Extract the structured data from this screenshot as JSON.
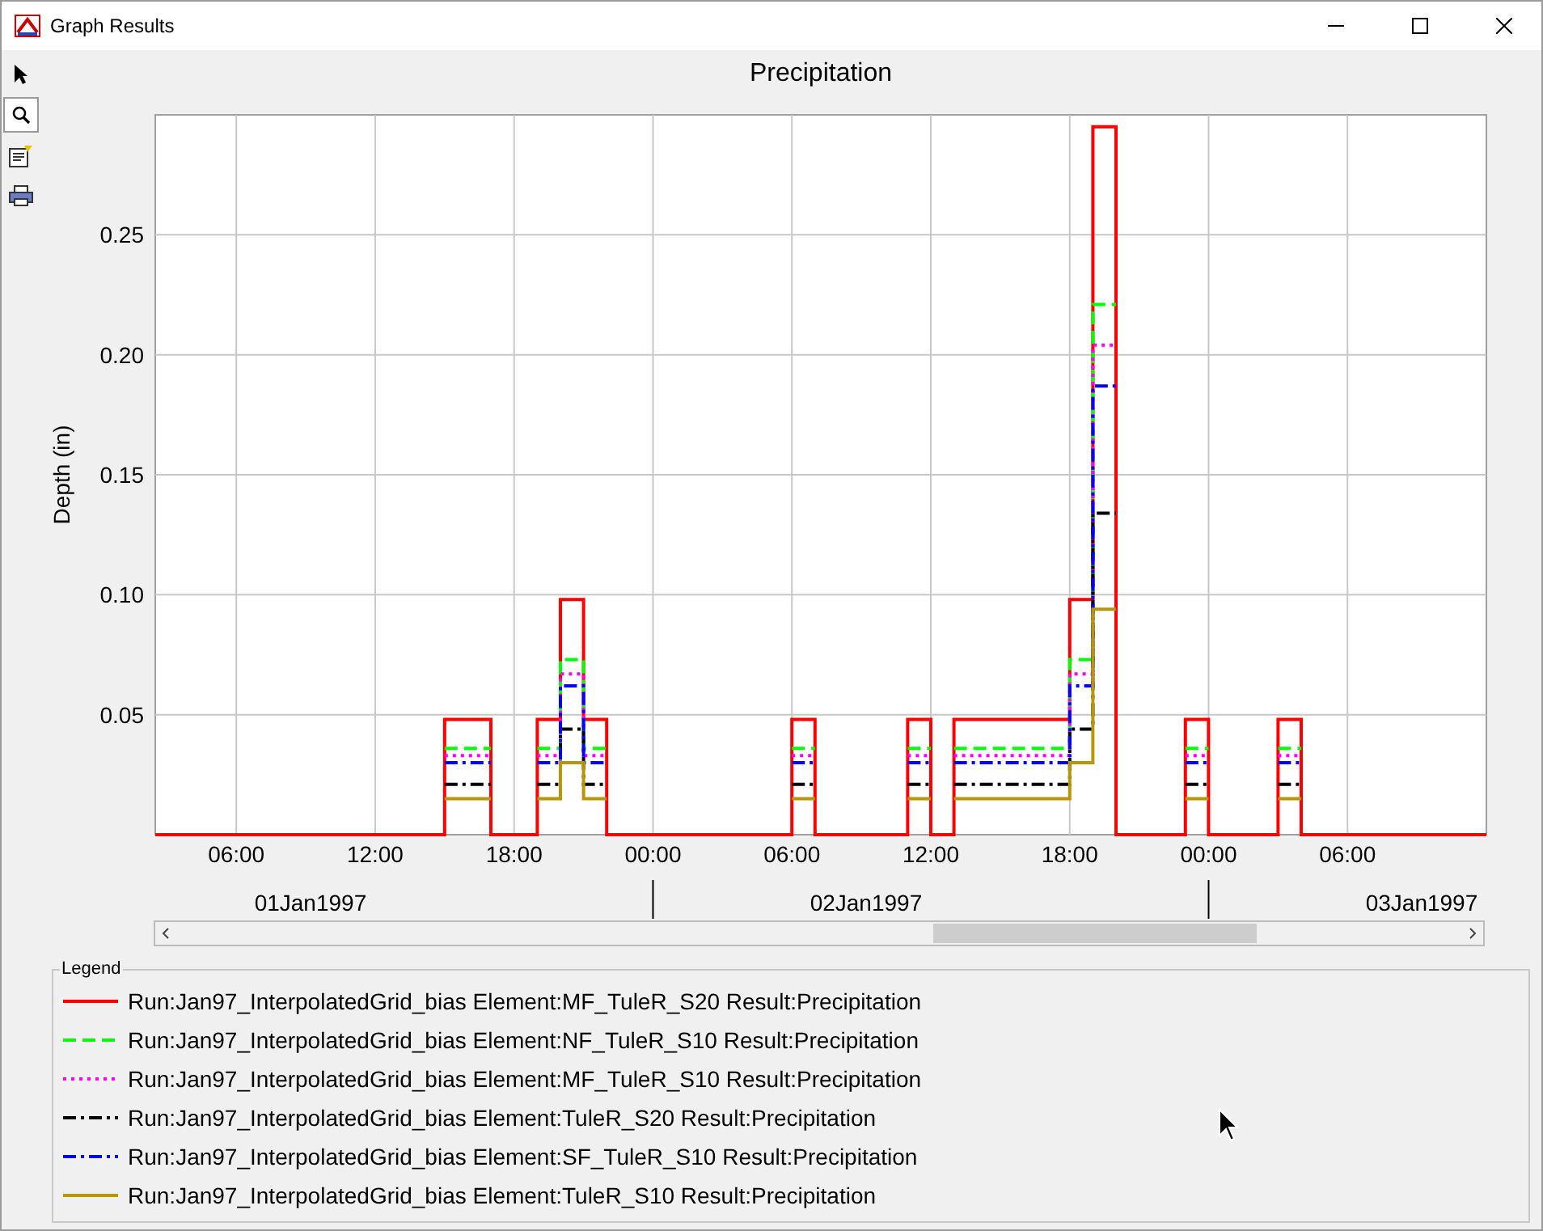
{
  "window": {
    "title": "Graph Results"
  },
  "tools": [
    {
      "kind": "pointer",
      "selected": false
    },
    {
      "kind": "zoom",
      "selected": true
    },
    {
      "kind": "properties",
      "selected": false
    },
    {
      "kind": "print",
      "selected": false
    }
  ],
  "chart": {
    "chart_data": {
      "type": "line",
      "title": "Precipitation",
      "ylabel": "Depth (in)",
      "grid": true,
      "xlim": [
        "1997-01-01T02:30",
        "1997-01-03T12:00"
      ],
      "ylim": [
        0,
        0.3
      ],
      "xticks": [
        {
          "value": "1997-01-01T06:00",
          "label": "06:00"
        },
        {
          "value": "1997-01-01T12:00",
          "label": "12:00"
        },
        {
          "value": "1997-01-01T18:00",
          "label": "18:00"
        },
        {
          "value": "1997-01-02T00:00",
          "label": "00:00"
        },
        {
          "value": "1997-01-02T06:00",
          "label": "06:00"
        },
        {
          "value": "1997-01-02T12:00",
          "label": "12:00"
        },
        {
          "value": "1997-01-02T18:00",
          "label": "18:00"
        },
        {
          "value": "1997-01-03T00:00",
          "label": "00:00"
        },
        {
          "value": "1997-01-03T06:00",
          "label": "06:00"
        }
      ],
      "yticks": [
        {
          "value": 0.05,
          "label": "0.05"
        },
        {
          "value": 0.1,
          "label": "0.10"
        },
        {
          "value": 0.15,
          "label": "0.15"
        },
        {
          "value": 0.2,
          "label": "0.20"
        },
        {
          "value": 0.25,
          "label": "0.25"
        }
      ],
      "x": [
        "1997-01-01T02:30",
        "1997-01-01T15:00",
        "1997-01-01T15:00",
        "1997-01-01T17:00",
        "1997-01-01T17:00",
        "1997-01-01T19:00",
        "1997-01-01T19:00",
        "1997-01-01T20:00",
        "1997-01-01T20:00",
        "1997-01-01T21:00",
        "1997-01-01T21:00",
        "1997-01-01T22:00",
        "1997-01-01T22:00",
        "1997-01-02T06:00",
        "1997-01-02T06:00",
        "1997-01-02T07:00",
        "1997-01-02T07:00",
        "1997-01-02T11:00",
        "1997-01-02T11:00",
        "1997-01-02T12:00",
        "1997-01-02T12:00",
        "1997-01-02T13:00",
        "1997-01-02T13:00",
        "1997-01-02T18:00",
        "1997-01-02T18:00",
        "1997-01-02T19:00",
        "1997-01-02T19:00",
        "1997-01-02T20:00",
        "1997-01-02T20:00",
        "1997-01-02T23:00",
        "1997-01-02T23:00",
        "1997-01-03T00:00",
        "1997-01-03T00:00",
        "1997-01-03T03:00",
        "1997-01-03T03:00",
        "1997-01-03T04:00",
        "1997-01-03T04:00",
        "1997-01-03T12:00"
      ],
      "series": [
        {
          "name": "Run:Jan97_InterpolatedGrid_bias Element:MF_TuleR_S20 Result:Precipitation",
          "color": "#ff0000",
          "line_style": "solid",
          "values": [
            0,
            0,
            0.048,
            0.048,
            0,
            0,
            0.048,
            0.048,
            0.098,
            0.098,
            0.048,
            0.048,
            0,
            0,
            0.048,
            0.048,
            0,
            0,
            0.048,
            0.048,
            0,
            0,
            0.048,
            0.048,
            0.098,
            0.098,
            0.295,
            0.295,
            0,
            0,
            0.048,
            0.048,
            0,
            0,
            0.048,
            0.048,
            0,
            0
          ]
        },
        {
          "name": "Run:Jan97_InterpolatedGrid_bias Element:NF_TuleR_S10 Result:Precipitation",
          "color": "#00ff00",
          "line_style": "dashed",
          "values": [
            null,
            null,
            0.036,
            0.036,
            null,
            null,
            0.036,
            0.036,
            0.073,
            0.073,
            0.036,
            0.036,
            null,
            null,
            0.036,
            0.036,
            null,
            null,
            0.036,
            0.036,
            null,
            null,
            0.036,
            0.036,
            0.073,
            0.073,
            0.221,
            0.221,
            null,
            null,
            0.036,
            0.036,
            null,
            null,
            0.036,
            0.036,
            null,
            null
          ]
        },
        {
          "name": "Run:Jan97_InterpolatedGrid_bias Element:MF_TuleR_S10 Result:Precipitation",
          "color": "#ff00ff",
          "line_style": "dotted",
          "values": [
            null,
            null,
            0.033,
            0.033,
            null,
            null,
            0.033,
            0.033,
            0.067,
            0.067,
            0.033,
            0.033,
            null,
            null,
            0.033,
            0.033,
            null,
            null,
            0.033,
            0.033,
            null,
            null,
            0.033,
            0.033,
            0.067,
            0.067,
            0.204,
            0.204,
            null,
            null,
            0.033,
            0.033,
            null,
            null,
            0.033,
            0.033,
            null,
            null
          ]
        },
        {
          "name": "Run:Jan97_InterpolatedGrid_bias Element:TuleR_S20 Result:Precipitation",
          "color": "#000000",
          "line_style": "dashdot",
          "values": [
            null,
            null,
            0.021,
            0.021,
            null,
            null,
            0.021,
            0.021,
            0.044,
            0.044,
            0.021,
            0.021,
            null,
            null,
            0.021,
            0.021,
            null,
            null,
            0.021,
            0.021,
            null,
            null,
            0.021,
            0.021,
            0.044,
            0.044,
            0.134,
            0.134,
            null,
            null,
            0.021,
            0.021,
            null,
            null,
            0.021,
            0.021,
            null,
            null
          ]
        },
        {
          "name": "Run:Jan97_InterpolatedGrid_bias Element:SF_TuleR_S10 Result:Precipitation",
          "color": "#0000ff",
          "line_style": "dashdot",
          "values": [
            null,
            null,
            0.03,
            0.03,
            null,
            null,
            0.03,
            0.03,
            0.062,
            0.062,
            0.03,
            0.03,
            null,
            null,
            0.03,
            0.03,
            null,
            null,
            0.03,
            0.03,
            null,
            null,
            0.03,
            0.03,
            0.062,
            0.062,
            0.187,
            0.187,
            null,
            null,
            0.03,
            0.03,
            null,
            null,
            0.03,
            0.03,
            null,
            null
          ]
        },
        {
          "name": "Run:Jan97_InterpolatedGrid_bias Element:TuleR_S10 Result:Precipitation",
          "color": "#b8960c",
          "line_style": "solid",
          "values": [
            null,
            null,
            0.015,
            0.015,
            null,
            null,
            0.015,
            0.015,
            0.03,
            0.03,
            0.015,
            0.015,
            null,
            null,
            0.015,
            0.015,
            null,
            null,
            0.015,
            0.015,
            null,
            null,
            0.015,
            0.015,
            0.03,
            0.03,
            0.094,
            0.094,
            null,
            null,
            0.015,
            0.015,
            null,
            null,
            0.015,
            0.015,
            null,
            null
          ]
        }
      ]
    },
    "dates": [
      "01Jan1997",
      "02Jan1997",
      "03Jan1997"
    ]
  },
  "legend": {
    "title": "Legend"
  }
}
